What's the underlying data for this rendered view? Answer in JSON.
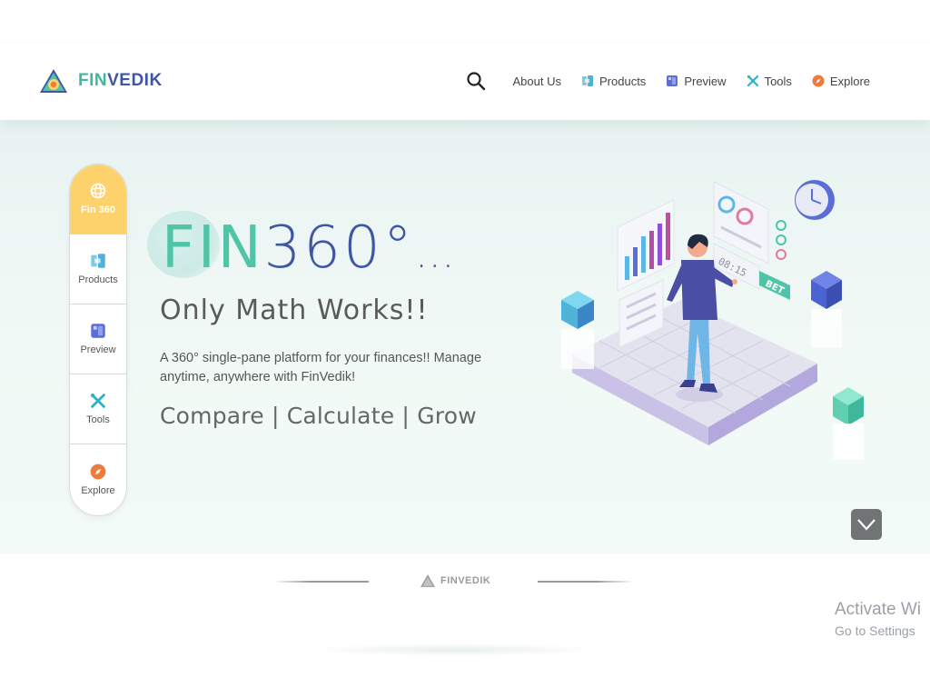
{
  "brand": {
    "word_part1": "FIN",
    "word_part2": "VEDIK"
  },
  "nav": {
    "search_icon": "search-icon",
    "items": [
      {
        "label": "About Us",
        "icon": ""
      },
      {
        "label": "Products",
        "icon": "products-icon"
      },
      {
        "label": "Preview",
        "icon": "preview-icon"
      },
      {
        "label": "Tools",
        "icon": "tools-icon"
      },
      {
        "label": "Explore",
        "icon": "explore-icon"
      }
    ]
  },
  "rail": {
    "items": [
      {
        "label": "Fin 360",
        "icon": "fin360-icon",
        "active": true
      },
      {
        "label": "Products",
        "icon": "products-icon"
      },
      {
        "label": "Preview",
        "icon": "preview-icon"
      },
      {
        "label": "Tools",
        "icon": "tools-icon"
      },
      {
        "label": "Explore",
        "icon": "explore-icon"
      }
    ]
  },
  "hero": {
    "headline_part1": "FIN",
    "headline_part2": "360°",
    "headline_part3": "…",
    "tagline": "Only Math Works!!",
    "description": "A 360° single-pane platform for your finances!! Manage anytime, anywhere with FinVedik!",
    "slogan": "Compare | Calculate | Grow",
    "illustration": {
      "board_text": "BET",
      "clock_text": "08:15"
    }
  },
  "footer": {
    "brand_label": "FINVEDIK"
  },
  "watermark": {
    "title": "Activate Wi",
    "subtitle": "Go to Settings"
  },
  "colors": {
    "teal": "#4fc4a6",
    "indigo": "#3f56a6",
    "rail_active": "#fdd16c",
    "explore_orange": "#f07a3a",
    "tools_teal": "#2ab3c9"
  }
}
